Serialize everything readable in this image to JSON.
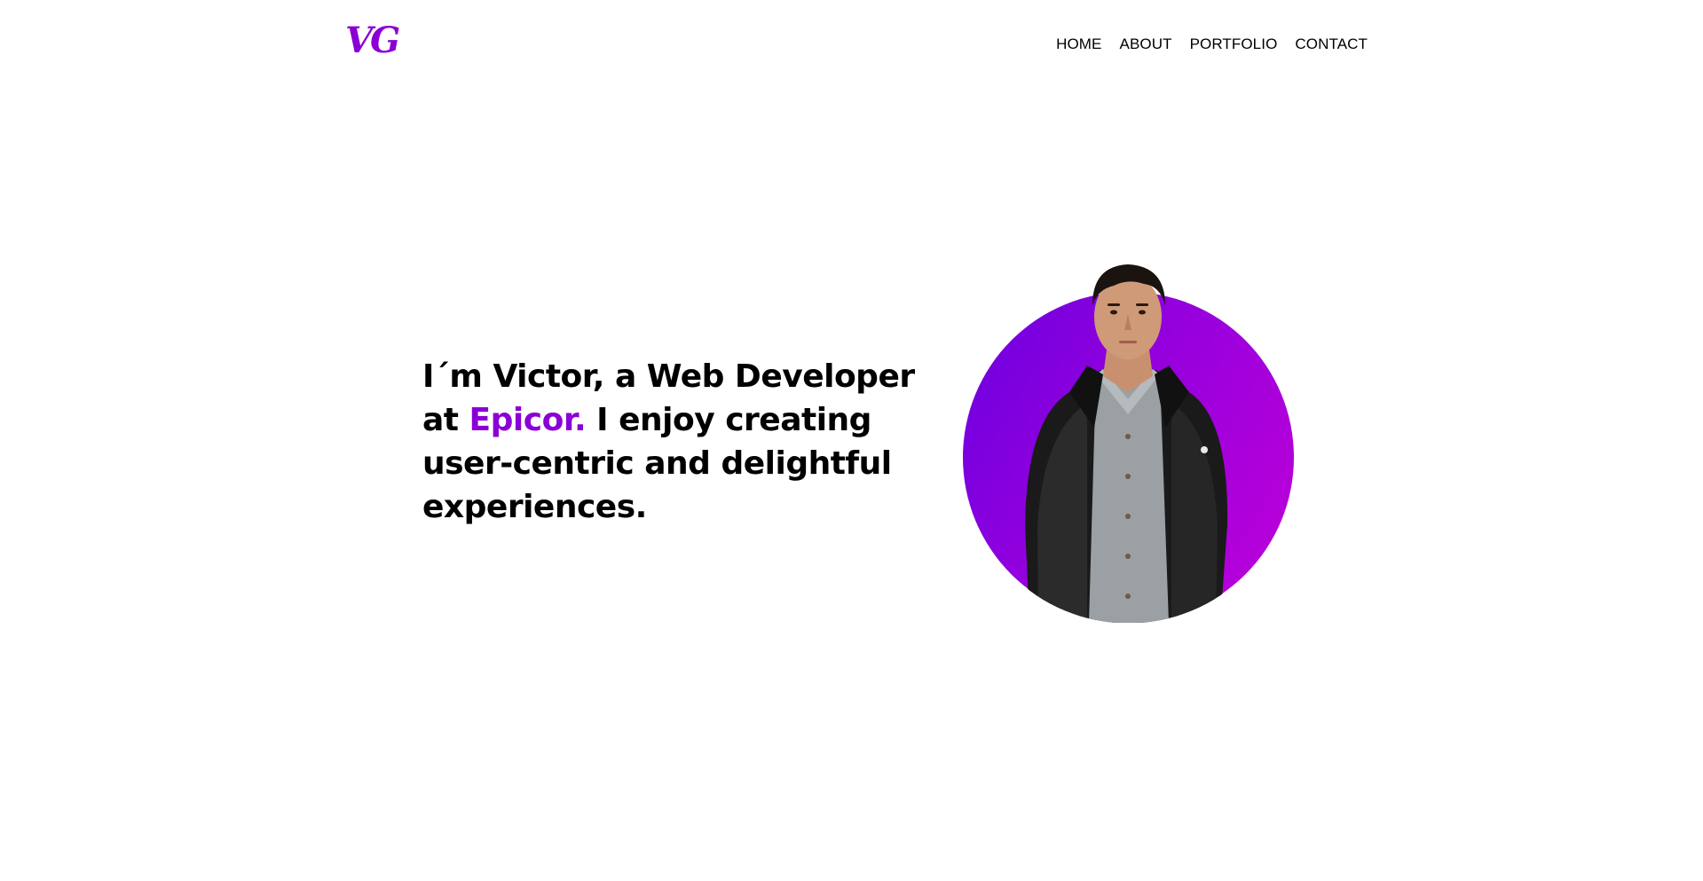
{
  "header": {
    "logo": "VG",
    "nav": [
      "HOME",
      "ABOUT",
      "PORTFOLIO",
      "CONTACT"
    ]
  },
  "hero": {
    "line_prefix": "I´m Victor, a Web Developer at ",
    "company": "Epicor.",
    "line_suffix": " I enjoy creating user-centric and delightful experiences."
  },
  "colors": {
    "accent": "#8a00d4",
    "gradient_start": "#6a00e0",
    "gradient_end": "#c000d8"
  },
  "icons": {
    "portrait": "profile-photo"
  }
}
